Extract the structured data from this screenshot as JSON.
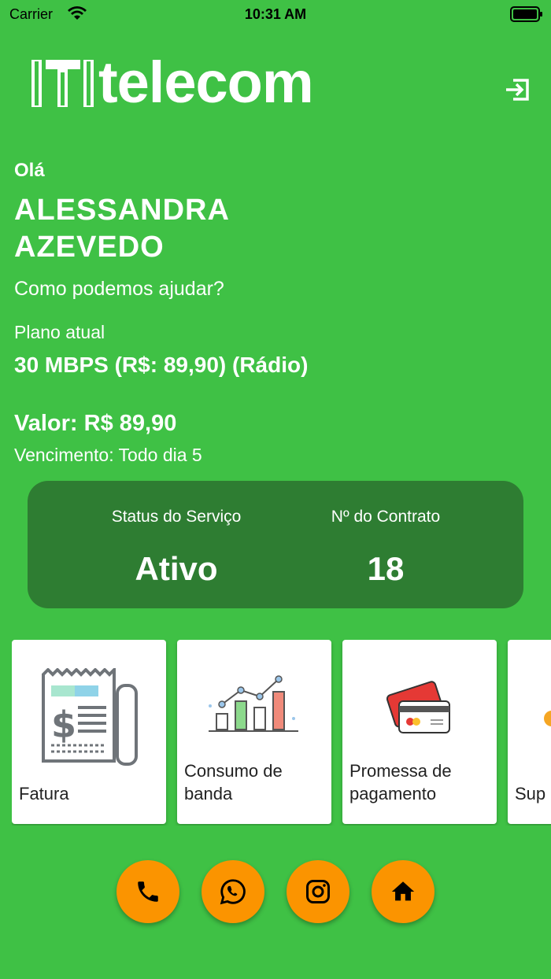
{
  "status_bar": {
    "carrier": "Carrier",
    "time": "10:31 AM"
  },
  "header": {
    "brand": "telecom",
    "logout_icon": "logout-icon"
  },
  "greeting": {
    "hello": "Olá",
    "name": "ALESSANDRA AZEVEDO",
    "help": "Como podemos ajudar?"
  },
  "plan": {
    "label": "Plano atual",
    "name": "30 MBPS (R$: 89,90) (Rádio)",
    "value": "Valor: R$ 89,90",
    "due": "Vencimento: Todo dia 5"
  },
  "service": {
    "status_label": "Status do Serviço",
    "status_value": "Ativo",
    "contract_label": "Nº do Contrato",
    "contract_value": "18"
  },
  "shortcuts": [
    {
      "label": "Fatura",
      "icon": "invoice-icon"
    },
    {
      "label": "Consumo de banda",
      "icon": "bandwidth-chart-icon"
    },
    {
      "label": "Promessa de pagamento",
      "icon": "payment-cards-icon"
    },
    {
      "label": "Sup",
      "icon": "support-icon"
    }
  ],
  "contact_buttons": [
    {
      "icon": "phone-icon"
    },
    {
      "icon": "whatsapp-icon"
    },
    {
      "icon": "instagram-icon"
    },
    {
      "icon": "home-icon"
    }
  ],
  "colors": {
    "background": "#3fc145",
    "card_dark": "#2e7d32",
    "fab": "#fb9400"
  }
}
